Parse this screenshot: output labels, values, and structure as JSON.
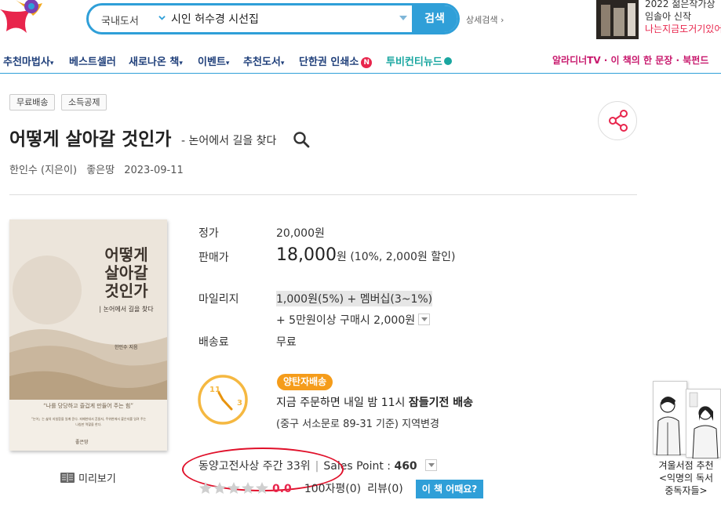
{
  "header": {
    "search_category": "국내도서",
    "search_query": "시인 허수경 시선집",
    "search_button": "검색",
    "advanced_search": "상세검색 ›",
    "promo_line1": "2022 젊은작가상",
    "promo_line2": "임솔아 신작",
    "promo_line3": "나는지금도거기있어"
  },
  "nav": {
    "items": [
      "추천마법사",
      "베스트셀러",
      "새로나온 책",
      "이벤트",
      "추천도서",
      "단한권 인쇄소",
      "투비컨티뉴드"
    ],
    "badge_n": "N",
    "right": "알라디너TV · 이 책의 한 문장 · 북펀드"
  },
  "product": {
    "tags": [
      "무료배송",
      "소득공제"
    ],
    "title": "어떻게 살아갈 것인가",
    "subtitle": "- 논어에서 길을 찾다",
    "author": "한인수 (지은이)",
    "publisher": "좋은땅",
    "date": "2023-09-11",
    "cover": {
      "title_lines": [
        "어떻게",
        "살아갈",
        "것인가"
      ],
      "subtitle": "| 논어에서 길을 찾다",
      "author": "한인수 지음",
      "quote": "“나를 당당하고 즐겁게 만들어 주는 힘”",
      "desc": "“논어」는 삶의 지침함을 일깨 준다. 피폐한데서 흔들지, 주위현에서 붙은지를 일려 주는 나침판 역할을 한다.",
      "publisher": "좋은땅"
    },
    "preview": "미리보기"
  },
  "price": {
    "list_label": "정가",
    "list_value": "20,000원",
    "sale_label": "판매가",
    "sale_value": "18,000",
    "sale_unit": "원",
    "sale_discount": "(10%, 2,000원 할인)",
    "mileage_label": "마일리지",
    "mileage_value": "1,000원(5%) + 멤버십(3~1%)",
    "mileage_extra": "+ 5만원이상 구매시 2,000원",
    "shipping_label": "배송료",
    "shipping_value": "무료"
  },
  "delivery": {
    "badge": "양탄자배송",
    "line1_prefix": "지금 주문하면 내일 밤 11시 ",
    "line1_bold": "잠들기전 배송",
    "line2": "(중구 서소문로 89-31 기준) 지역변경",
    "clock_num1": "11",
    "clock_num2": "3"
  },
  "rank": {
    "text": "동양고전사상 주간 33위",
    "sep": "|",
    "sales_point_label": "Sales Point : ",
    "sales_point_value": "460",
    "score": "0.0",
    "review_count": "100자평(0)",
    "review": "리뷰(0)",
    "cta": "이 책 어때요?",
    "stars_filled": 0
  },
  "side_promo": {
    "line1": "겨울서점 추천",
    "line2": "<익명의 독서",
    "line3": "중독자들>"
  },
  "colors": {
    "accent": "#2f9fd8",
    "nav_text": "#1f3f7a",
    "highlight_red": "#e8254c",
    "orange_badge": "#f59c1a",
    "annotation_ellipse": "#e0102a"
  }
}
